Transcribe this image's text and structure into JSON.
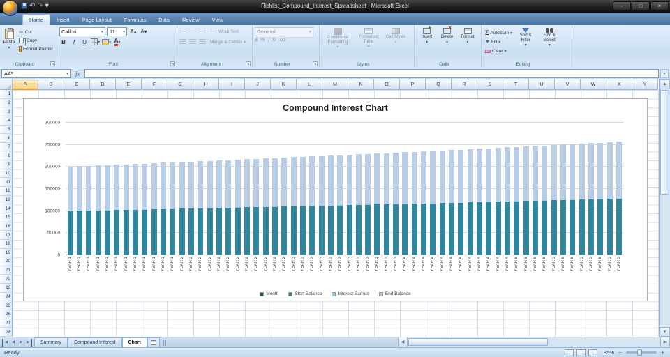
{
  "window": {
    "title": "Richlist_Compound_Interest_Spreadsheet - Microsoft Excel"
  },
  "icons": {
    "undo": "↶",
    "redo": "↷",
    "dropdown": "▾",
    "minimize": "–",
    "maximize": "□",
    "close": "×",
    "cut": "✂",
    "launcher": "↘",
    "scroll_up": "▲",
    "scroll_down": "▼",
    "scroll_left": "◀",
    "scroll_right": "▶",
    "nav_prev": "◀",
    "nav_next": "▶",
    "sum": "Σ",
    "fill_arrow": "▼",
    "dollar": "$",
    "percent": "%",
    "comma": ",",
    "inc_decimal": ".0",
    "dec_decimal": ".00",
    "grow_font": "A▴",
    "shrink_font": "A▾",
    "bold": "B",
    "italic": "I",
    "underline": "U",
    "font_color_letter": "A",
    "expand_formula_bar": "▾",
    "zoom_out": "−",
    "zoom_in": "+"
  },
  "ribbon_tabs": [
    {
      "label": "Home",
      "active": true
    },
    {
      "label": "Insert",
      "active": false
    },
    {
      "label": "Page Layout",
      "active": false
    },
    {
      "label": "Formulas",
      "active": false
    },
    {
      "label": "Data",
      "active": false
    },
    {
      "label": "Review",
      "active": false
    },
    {
      "label": "View",
      "active": false
    }
  ],
  "ribbon": {
    "clipboard": {
      "group_label": "Clipboard",
      "paste": "Paste",
      "cut": "Cut",
      "copy": "Copy",
      "format_painter": "Format Painter"
    },
    "font": {
      "group_label": "Font",
      "font_name": "Calibri",
      "font_size": "11"
    },
    "alignment": {
      "group_label": "Alignment",
      "wrap_text": "Wrap Text",
      "merge_center": "Merge & Center"
    },
    "number": {
      "group_label": "Number",
      "format": "General"
    },
    "styles": {
      "group_label": "Styles",
      "conditional_formatting": "Conditional Formatting",
      "format_as_table": "Format as Table",
      "cell_styles": "Cell Styles"
    },
    "cells": {
      "group_label": "Cells",
      "insert": "Insert",
      "delete": "Delete",
      "format": "Format"
    },
    "editing": {
      "group_label": "Editing",
      "autosum": "AutoSum",
      "fill": "Fill",
      "clear": "Clear",
      "sort_filter": "Sort & Filter",
      "find_select": "Find & Select"
    }
  },
  "formula_bar": {
    "name_box": "A43",
    "fx_label": "fx",
    "formula_value": ""
  },
  "grid": {
    "columns": [
      "A",
      "B",
      "C",
      "D",
      "E",
      "F",
      "G",
      "H",
      "I",
      "J",
      "K",
      "L",
      "M",
      "N",
      "O",
      "P",
      "Q",
      "R",
      "S",
      "T",
      "U",
      "V",
      "W",
      "X",
      "Y"
    ],
    "active_column": "A",
    "rows": [
      1,
      2,
      3,
      4,
      5,
      6,
      7,
      8,
      9,
      10,
      11,
      12,
      13,
      14,
      15,
      16,
      17,
      18,
      19,
      20,
      21,
      22,
      23,
      24,
      25,
      26,
      27,
      28
    ]
  },
  "chart_data": {
    "type": "bar",
    "stacked": true,
    "title": "Compound Interest Chart",
    "xlabel": "",
    "ylabel": "",
    "ylim": [
      0,
      300000
    ],
    "ytick_interval": 50000,
    "yticks": [
      0,
      50000,
      100000,
      150000,
      200000,
      250000,
      300000
    ],
    "grid": true,
    "legend_position": "bottom",
    "categories": [
      "YEAR 1",
      "YEAR 1",
      "YEAR 1",
      "YEAR 1",
      "YEAR 1",
      "YEAR 1",
      "YEAR 1",
      "YEAR 1",
      "YEAR 1",
      "YEAR 1",
      "YEAR 1",
      "YEAR 1",
      "YEAR 2",
      "YEAR 2",
      "YEAR 2",
      "YEAR 2",
      "YEAR 2",
      "YEAR 2",
      "YEAR 2",
      "YEAR 2",
      "YEAR 2",
      "YEAR 2",
      "YEAR 2",
      "YEAR 2",
      "YEAR 3",
      "YEAR 3",
      "YEAR 3",
      "YEAR 3",
      "YEAR 3",
      "YEAR 3",
      "YEAR 3",
      "YEAR 3",
      "YEAR 3",
      "YEAR 3",
      "YEAR 3",
      "YEAR 3",
      "YEAR 4",
      "YEAR 4",
      "YEAR 4",
      "YEAR 4",
      "YEAR 4",
      "YEAR 4",
      "YEAR 4",
      "YEAR 4",
      "YEAR 4",
      "YEAR 4",
      "YEAR 4",
      "YEAR 4",
      "YEAR 5",
      "YEAR 5",
      "YEAR 5",
      "YEAR 5",
      "YEAR 5",
      "YEAR 5",
      "YEAR 5",
      "YEAR 5",
      "YEAR 5",
      "YEAR 5",
      "YEAR 5",
      "YEAR 5"
    ],
    "series": [
      {
        "name": "Month",
        "color": "#205867",
        "values": [
          1,
          2,
          3,
          4,
          5,
          6,
          7,
          8,
          9,
          10,
          11,
          12,
          1,
          2,
          3,
          4,
          5,
          6,
          7,
          8,
          9,
          10,
          11,
          12,
          1,
          2,
          3,
          4,
          5,
          6,
          7,
          8,
          9,
          10,
          11,
          12,
          1,
          2,
          3,
          4,
          5,
          6,
          7,
          8,
          9,
          10,
          11,
          12,
          1,
          2,
          3,
          4,
          5,
          6,
          7,
          8,
          9,
          10,
          11,
          12
        ]
      },
      {
        "name": "Start Balance",
        "color": "#31859C",
        "values": [
          100000,
          100417,
          100835,
          101255,
          101677,
          102101,
          102526,
          102953,
          103382,
          103813,
          104246,
          104680,
          105116,
          105554,
          105994,
          106436,
          106879,
          107324,
          107772,
          108221,
          108672,
          109124,
          109579,
          110036,
          110494,
          110955,
          111417,
          111881,
          112347,
          112815,
          113285,
          113757,
          114231,
          114707,
          115185,
          115665,
          116147,
          116631,
          117117,
          117605,
          118095,
          118587,
          119081,
          119577,
          120076,
          120576,
          121078,
          121583,
          122090,
          122598,
          123109,
          123622,
          124137,
          124654,
          125174,
          125695,
          126219,
          126745,
          127273,
          127803
        ]
      },
      {
        "name": "Interest Earned",
        "color": "#92CDDC",
        "values": [
          417,
          418,
          420,
          422,
          424,
          425,
          427,
          429,
          431,
          433,
          434,
          436,
          438,
          440,
          442,
          443,
          445,
          447,
          449,
          451,
          453,
          455,
          457,
          458,
          460,
          462,
          464,
          466,
          468,
          470,
          472,
          474,
          476,
          478,
          480,
          482,
          484,
          486,
          488,
          490,
          492,
          494,
          496,
          498,
          500,
          502,
          504,
          507,
          509,
          511,
          513,
          515,
          517,
          519,
          522,
          524,
          526,
          528,
          530,
          533
        ]
      },
      {
        "name": "End Balance",
        "color": "#B9CDE5",
        "values": [
          100417,
          100835,
          101255,
          101677,
          102101,
          102526,
          102953,
          103382,
          103813,
          104246,
          104680,
          105116,
          105554,
          105994,
          106436,
          106879,
          107324,
          107772,
          108221,
          108672,
          109124,
          109579,
          110036,
          110494,
          110955,
          111417,
          111881,
          112347,
          112815,
          113285,
          113757,
          114231,
          114707,
          115185,
          115665,
          116147,
          116631,
          117117,
          117605,
          118095,
          118587,
          119081,
          119577,
          120076,
          120576,
          121078,
          121583,
          122090,
          122598,
          123109,
          123622,
          124137,
          124654,
          125174,
          125695,
          126219,
          126745,
          127273,
          127803,
          128336
        ]
      }
    ]
  },
  "sheet_bar": {
    "tabs": [
      {
        "label": "Summary",
        "active": false
      },
      {
        "label": "Compound Interest",
        "active": false
      },
      {
        "label": "Chart",
        "active": true
      }
    ]
  },
  "status_bar": {
    "mode": "Ready",
    "zoom": "85%"
  }
}
